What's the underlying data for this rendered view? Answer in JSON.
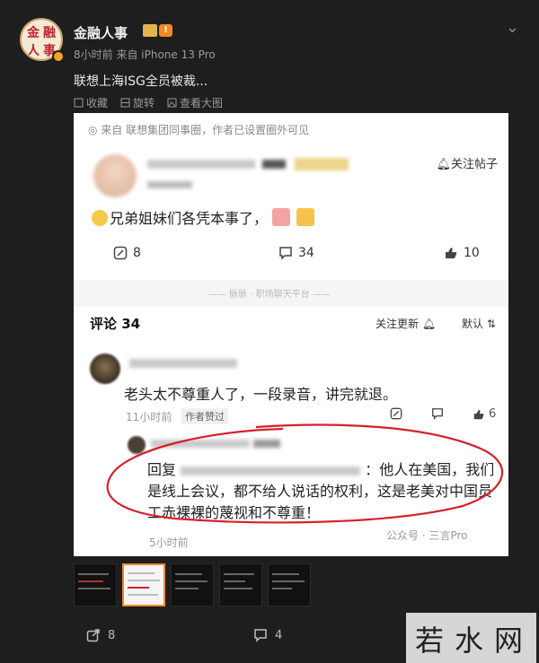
{
  "header": {
    "author": "金融人事",
    "avatar_text": [
      "金",
      "融",
      "人",
      "事"
    ],
    "level_badge": "!",
    "meta": "8小时前  来自 iPhone 13 Pro",
    "more_icon": "⌄"
  },
  "post": {
    "text": "联想上海ISG全员被裁...",
    "actions": {
      "collect": "收藏",
      "rotate": "旋转",
      "view_large": "查看大图"
    }
  },
  "screenshot": {
    "source": "来自 联想集团同事圈，作者已设置圈外可见",
    "follow_post": "关注帖子",
    "body": "兄弟姐妹们各凭本事了，",
    "stats": {
      "reposts": "8",
      "comments": "34",
      "likes": "10"
    },
    "divider_text": "—— 脉脉 · 职场聊天平台 ——",
    "comments": {
      "title": "评论 34",
      "sort_follow": "关注更新",
      "sort_default": "默认"
    },
    "comment": {
      "text": "老头太不尊重人了，一段录音，讲完就退。",
      "time": "11小时前",
      "tag": "作者赞过",
      "likes": "6"
    },
    "reply": {
      "prefix": "回复",
      "text": "：他人在美国，我们是线上会议，都不给人说话的权利，这是老美对中国员工赤裸裸的蔑视和不尊重！",
      "time": "5小时前"
    },
    "watermark": "公众号 · 三言Pro"
  },
  "bottom": {
    "reposts": "8",
    "comments": "4"
  },
  "site_watermark": "若水网",
  "colors": {
    "background": "#1e1e1e",
    "accent_orange": "#f08a24",
    "annotation_red": "#d6202a"
  }
}
